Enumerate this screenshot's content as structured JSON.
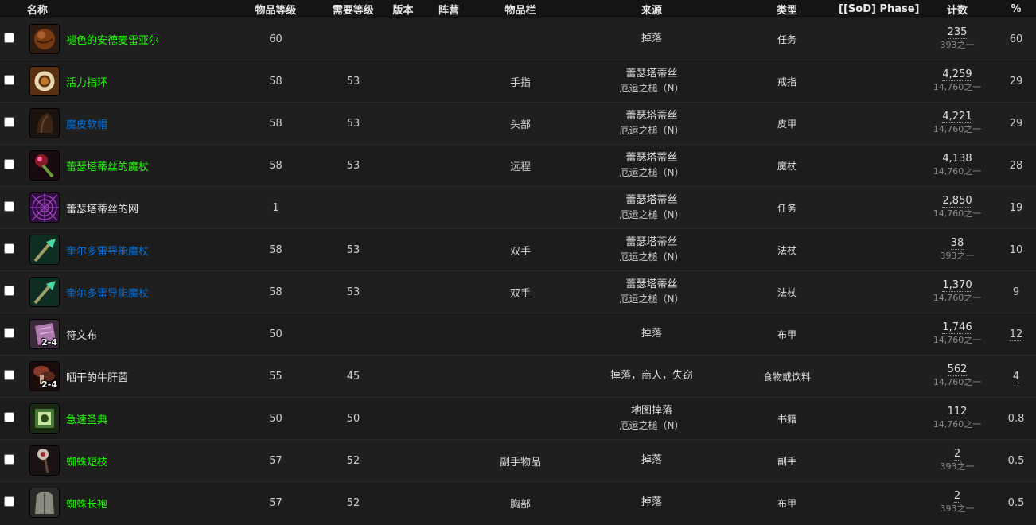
{
  "headers": {
    "name": "名称",
    "item_level": "物品等级",
    "req_level": "需要等级",
    "version": "版本",
    "faction": "阵营",
    "slot": "物品栏",
    "source": "来源",
    "type": "类型",
    "phase": "[[SoD] Phase]",
    "count": "计数",
    "percent": "%"
  },
  "icon_colors": {
    "brown": "#7a3a12",
    "ring": "#c27a2a",
    "hat": "#3a2415",
    "wand": "#8a1a2a",
    "web": "#5a1a7a",
    "staff": "#1a6a4a",
    "cloth": "#b07ab0",
    "mushroom": "#5a2a20",
    "book": "#4a7a3a",
    "stick": "#3a2a2a",
    "robe": "#8a8a80"
  },
  "rows": [
    {
      "icon": "brown-orb-icon",
      "name": "褪色的安德麦雷亚尔",
      "quality_color": "#1eff00",
      "item_level": "60",
      "req_level": "",
      "slot": "",
      "source_main": "掉落",
      "source_sub": "",
      "type": "任务",
      "count": "235",
      "count_sub": "393之一",
      "percent": "60",
      "stack": ""
    },
    {
      "icon": "ring-icon",
      "name": "活力指环",
      "quality_color": "#1eff00",
      "item_level": "58",
      "req_level": "53",
      "slot": "手指",
      "source_main": "蕾瑟塔蒂丝",
      "source_sub": "厄运之槌（N）",
      "type": "戒指",
      "count": "4,259",
      "count_sub": "14,760之一",
      "percent": "29",
      "stack": ""
    },
    {
      "icon": "hat-icon",
      "name": "魔皮软帽",
      "quality_color": "#0070dd",
      "item_level": "58",
      "req_level": "53",
      "slot": "头部",
      "source_main": "蕾瑟塔蒂丝",
      "source_sub": "厄运之槌（N）",
      "type": "皮甲",
      "count": "4,221",
      "count_sub": "14,760之一",
      "percent": "29",
      "stack": ""
    },
    {
      "icon": "wand-icon",
      "name": "蕾瑟塔蒂丝的魔杖",
      "quality_color": "#1eff00",
      "item_level": "58",
      "req_level": "53",
      "slot": "远程",
      "source_main": "蕾瑟塔蒂丝",
      "source_sub": "厄运之槌（N）",
      "type": "魔杖",
      "count": "4,138",
      "count_sub": "14,760之一",
      "percent": "28",
      "stack": ""
    },
    {
      "icon": "web-icon",
      "name": "蕾瑟塔蒂丝的网",
      "quality_color": "#e6e6e6",
      "item_level": "1",
      "req_level": "",
      "slot": "",
      "source_main": "蕾瑟塔蒂丝",
      "source_sub": "厄运之槌（N）",
      "type": "任务",
      "count": "2,850",
      "count_sub": "14,760之一",
      "percent": "19",
      "stack": ""
    },
    {
      "icon": "staff-icon",
      "name": "奎尔多雷导能魔杖",
      "quality_color": "#0070dd",
      "item_level": "58",
      "req_level": "53",
      "slot": "双手",
      "source_main": "蕾瑟塔蒂丝",
      "source_sub": "厄运之槌（N）",
      "type": "法杖",
      "count": "38",
      "count_sub": "393之一",
      "percent": "10",
      "stack": ""
    },
    {
      "icon": "staff-icon",
      "name": "奎尔多雷导能魔杖",
      "quality_color": "#0070dd",
      "item_level": "58",
      "req_level": "53",
      "slot": "双手",
      "source_main": "蕾瑟塔蒂丝",
      "source_sub": "厄运之槌（N）",
      "type": "法杖",
      "count": "1,370",
      "count_sub": "14,760之一",
      "percent": "9",
      "stack": ""
    },
    {
      "icon": "cloth-icon",
      "name": "符文布",
      "quality_color": "#e6e6e6",
      "item_level": "50",
      "req_level": "",
      "slot": "",
      "source_main": "掉落",
      "source_sub": "",
      "type": "布甲",
      "count": "1,746",
      "count_sub": "14,760之一",
      "percent": "12",
      "stack": "2-4"
    },
    {
      "icon": "mushroom-icon",
      "name": "晒干的牛肝菌",
      "quality_color": "#e6e6e6",
      "item_level": "55",
      "req_level": "45",
      "slot": "",
      "source_main": "掉落，商人，失窃",
      "source_sub": "",
      "type": "食物或饮料",
      "count": "562",
      "count_sub": "14,760之一",
      "percent": "4",
      "stack": "2-4"
    },
    {
      "icon": "book-icon",
      "name": "急速圣典",
      "quality_color": "#1eff00",
      "item_level": "50",
      "req_level": "50",
      "slot": "",
      "source_main": "地图掉落",
      "source_sub": "厄运之槌（N）",
      "type": "书籍",
      "count": "112",
      "count_sub": "14,760之一",
      "percent": "0.8",
      "stack": ""
    },
    {
      "icon": "stick-icon",
      "name": "蜘蛛短枝",
      "quality_color": "#1eff00",
      "item_level": "57",
      "req_level": "52",
      "slot": "副手物品",
      "source_main": "掉落",
      "source_sub": "",
      "type": "副手",
      "count": "2",
      "count_sub": "393之一",
      "percent": "0.5",
      "stack": ""
    },
    {
      "icon": "robe-icon",
      "name": "蜘蛛长袍",
      "quality_color": "#1eff00",
      "item_level": "57",
      "req_level": "52",
      "slot": "胸部",
      "source_main": "掉落",
      "source_sub": "",
      "type": "布甲",
      "count": "2",
      "count_sub": "393之一",
      "percent": "0.5",
      "stack": ""
    }
  ]
}
